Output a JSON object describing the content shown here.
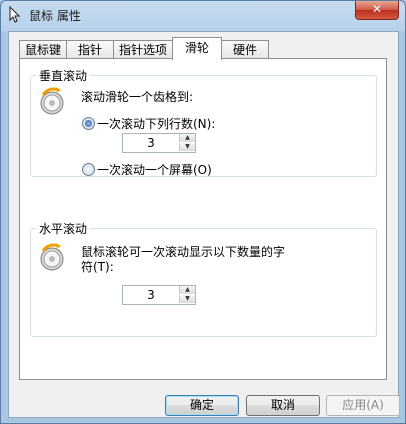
{
  "window": {
    "title": "鼠标 属性",
    "close_label": "✕"
  },
  "tabs": [
    {
      "label": "鼠标键"
    },
    {
      "label": "指针"
    },
    {
      "label": "指针选项"
    },
    {
      "label": "滑轮"
    },
    {
      "label": "硬件"
    }
  ],
  "vertical": {
    "group_label": "垂直滚动",
    "prompt": "滚动滑轮一个齿格到:",
    "option_lines_label": "一次滚动下列行数(N):",
    "option_lines_selected": true,
    "lines_value": "3",
    "option_screen_label": "一次滚动一个屏幕(O)",
    "option_screen_selected": false
  },
  "horizontal": {
    "group_label": "水平滚动",
    "prompt_line1": "鼠标滚轮可一次滚动显示以下数量的字",
    "prompt_line2": "符(T):",
    "chars_value": "3"
  },
  "buttons": {
    "ok": "确定",
    "cancel": "取消",
    "apply": "应用(A)"
  },
  "icons": {
    "title": "mouse-pointer-icon",
    "wheel": "scroll-wheel-icon",
    "spin_up": "▲",
    "spin_down": "▼"
  }
}
